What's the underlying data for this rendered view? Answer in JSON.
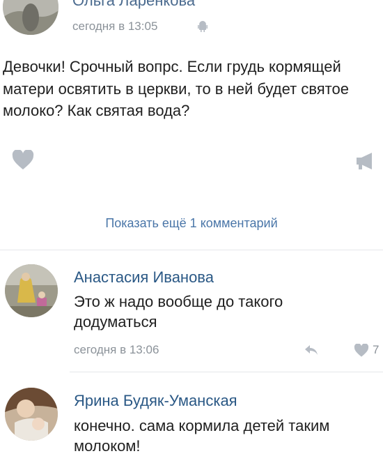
{
  "post": {
    "author": "Ольга Ларенкова",
    "time": "сегодня в 13:05",
    "text": "Девочки! Срочный вопрс. Если грудь кормящей матери освятить в церкви, то в ней будет святое молоко? Как святая вода?",
    "icons": {
      "like": "heart-icon",
      "share": "megaphone-icon",
      "device": "android-icon"
    }
  },
  "show_more": "Показать ещё 1 комментарий",
  "comments": [
    {
      "author": "Анастасия Иванова",
      "text": "Это ж надо вообще до такого додуматься",
      "time": "сегодня в 13:06",
      "likes": "7",
      "icons": {
        "reply": "reply-icon",
        "like": "heart-icon"
      }
    },
    {
      "author": "Ярина Будяк-Уманская",
      "text": "конечно. сама кормила детей таким молоком!"
    }
  ],
  "colors": {
    "name": "#2a5885",
    "link": "#4a76a8",
    "meta": "#8b9299",
    "icon": "#b6bcc4",
    "divider": "#e5e7ea"
  }
}
